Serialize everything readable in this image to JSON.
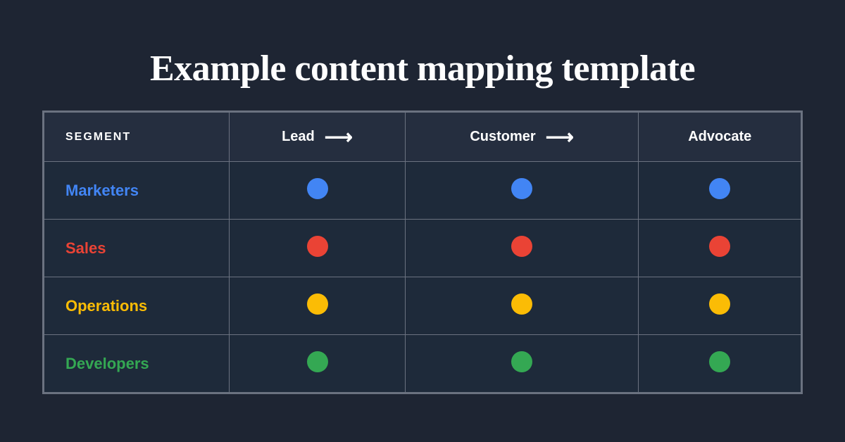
{
  "title": "Example content mapping template",
  "table": {
    "segment_header": "SEGMENT",
    "stages": [
      {
        "label": "Lead"
      },
      {
        "label": "Customer"
      },
      {
        "label": "Advocate"
      }
    ],
    "rows": [
      {
        "label": "Marketers",
        "color_class": "label-blue",
        "dot_class": "dot-blue"
      },
      {
        "label": "Sales",
        "color_class": "label-red",
        "dot_class": "dot-red"
      },
      {
        "label": "Operations",
        "color_class": "label-yellow",
        "dot_class": "dot-yellow"
      },
      {
        "label": "Developers",
        "color_class": "label-green",
        "dot_class": "dot-green"
      }
    ]
  }
}
